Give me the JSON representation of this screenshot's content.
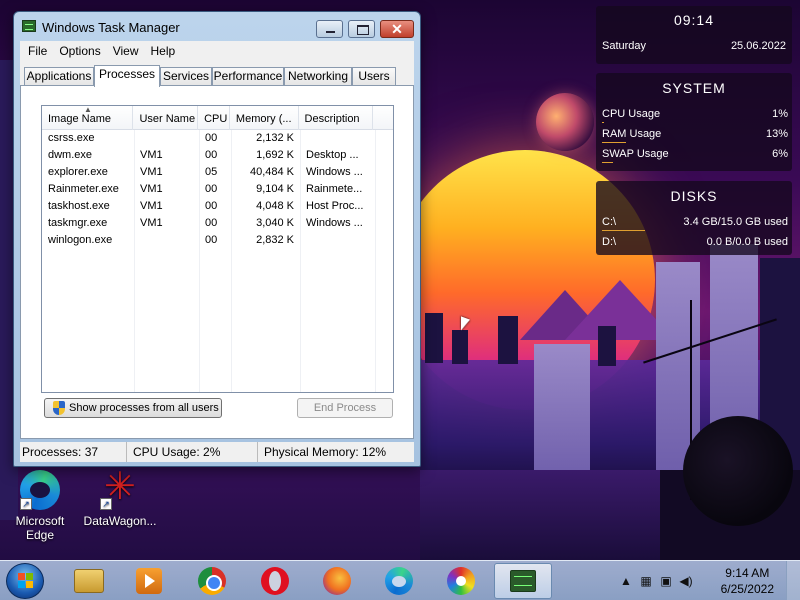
{
  "rainmeter": {
    "clock": {
      "time": "09:14",
      "day": "Saturday",
      "date": "25.06.2022"
    },
    "system": {
      "title": "SYSTEM",
      "rows": [
        {
          "label": "CPU Usage",
          "value": "1%",
          "level": 0.01
        },
        {
          "label": "RAM Usage",
          "value": "13%",
          "level": 0.13
        },
        {
          "label": "SWAP Usage",
          "value": "6%",
          "level": 0.06
        }
      ]
    },
    "disks": {
      "title": "DISKS",
      "rows": [
        {
          "label": "C:\\",
          "value": "3.4 GB/15.0 GB used",
          "level": 0.23
        },
        {
          "label": "D:\\",
          "value": "0.0 B/0.0 B used",
          "level": 0
        }
      ]
    }
  },
  "desktop_icons": [
    {
      "label": "Microsoft Edge",
      "icon": "edge-icon"
    },
    {
      "label": "DataWagon...",
      "icon": "datawagon-icon"
    }
  ],
  "task_manager": {
    "title": "Windows Task Manager",
    "menu": [
      "File",
      "Options",
      "View",
      "Help"
    ],
    "tabs": [
      "Applications",
      "Processes",
      "Services",
      "Performance",
      "Networking",
      "Users"
    ],
    "active_tab": "Processes",
    "columns": [
      "Image Name",
      "User Name",
      "CPU",
      "Memory (...",
      "Description"
    ],
    "processes": [
      {
        "image": "csrss.exe",
        "user": "",
        "cpu": "00",
        "memory": "2,132 K",
        "description": ""
      },
      {
        "image": "dwm.exe",
        "user": "VM1",
        "cpu": "00",
        "memory": "1,692 K",
        "description": "Desktop ..."
      },
      {
        "image": "explorer.exe",
        "user": "VM1",
        "cpu": "05",
        "memory": "40,484 K",
        "description": "Windows ..."
      },
      {
        "image": "Rainmeter.exe",
        "user": "VM1",
        "cpu": "00",
        "memory": "9,104 K",
        "description": "Rainmete..."
      },
      {
        "image": "taskhost.exe",
        "user": "VM1",
        "cpu": "00",
        "memory": "4,048 K",
        "description": "Host Proc..."
      },
      {
        "image": "taskmgr.exe",
        "user": "VM1",
        "cpu": "00",
        "memory": "3,040 K",
        "description": "Windows ..."
      },
      {
        "image": "winlogon.exe",
        "user": "",
        "cpu": "00",
        "memory": "2,832 K",
        "description": ""
      }
    ],
    "show_all_button": "Show processes from all users",
    "end_process_button": "End Process",
    "status": {
      "processes": "Processes: 37",
      "cpu": "CPU Usage: 2%",
      "memory": "Physical Memory: 12%"
    }
  },
  "taskbar": {
    "apps": [
      {
        "name": "windows-explorer-icon",
        "active": false
      },
      {
        "name": "media-player-icon",
        "active": false
      },
      {
        "name": "chrome-icon",
        "active": false
      },
      {
        "name": "opera-icon",
        "active": false
      },
      {
        "name": "firefox-icon",
        "active": false
      },
      {
        "name": "edge-icon",
        "active": false
      },
      {
        "name": "photos-icon",
        "active": false
      },
      {
        "name": "task-manager-icon",
        "active": true
      }
    ],
    "clock": {
      "time": "9:14 AM",
      "date": "6/25/2022"
    }
  }
}
